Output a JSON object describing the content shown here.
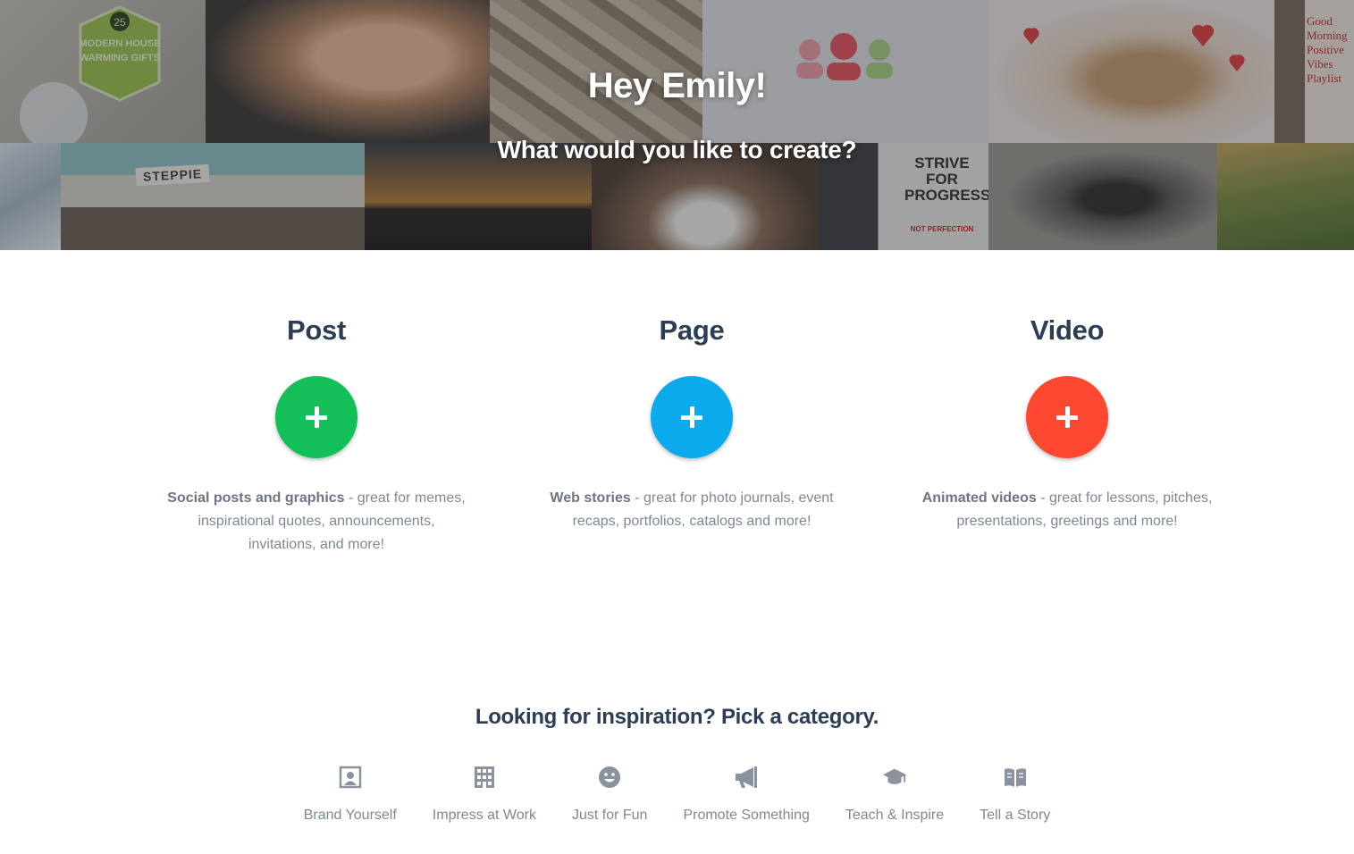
{
  "hero": {
    "greeting": "Hey Emily!",
    "prompt": "What would you like to create?",
    "collage": {
      "tile_giftbadge_number": "25",
      "tile_giftbadge_text": "MODERN HOUSE WARMING GIFTS",
      "tile_stand_sign": "STEPPIE",
      "tile_strive_text": "STRIVE FOR PROGRESS",
      "tile_strive_small": "NOT PERFECTION",
      "tile_playlist_text": "Good Morning Positive Vibes Playlist"
    }
  },
  "options": [
    {
      "title": "Post",
      "color": "#13bf57",
      "desc_strong": "Social posts and graphics",
      "desc_rest": " - great for memes, inspirational quotes, announcements, invitations, and more!"
    },
    {
      "title": "Page",
      "color": "#0aaaec",
      "desc_strong": "Web stories",
      "desc_rest": " - great for photo journals, event recaps, portfolios, catalogs and more!"
    },
    {
      "title": "Video",
      "color": "#fd4830",
      "desc_strong": "Animated videos",
      "desc_rest": " - great for lessons, pitches, presentations, greetings and more!"
    }
  ],
  "categories": {
    "heading": "Looking for inspiration? Pick a category.",
    "items": [
      {
        "label": "Brand Yourself",
        "icon": "portrait-icon"
      },
      {
        "label": "Impress at Work",
        "icon": "building-icon"
      },
      {
        "label": "Just for Fun",
        "icon": "smiley-icon"
      },
      {
        "label": "Promote Something",
        "icon": "megaphone-icon"
      },
      {
        "label": "Teach & Inspire",
        "icon": "graduation-cap-icon"
      },
      {
        "label": "Tell a Story",
        "icon": "book-icon"
      }
    ]
  },
  "colors": {
    "heading": "#2b3e55",
    "body_text": "#7e8896",
    "icon": "#8a929e"
  }
}
